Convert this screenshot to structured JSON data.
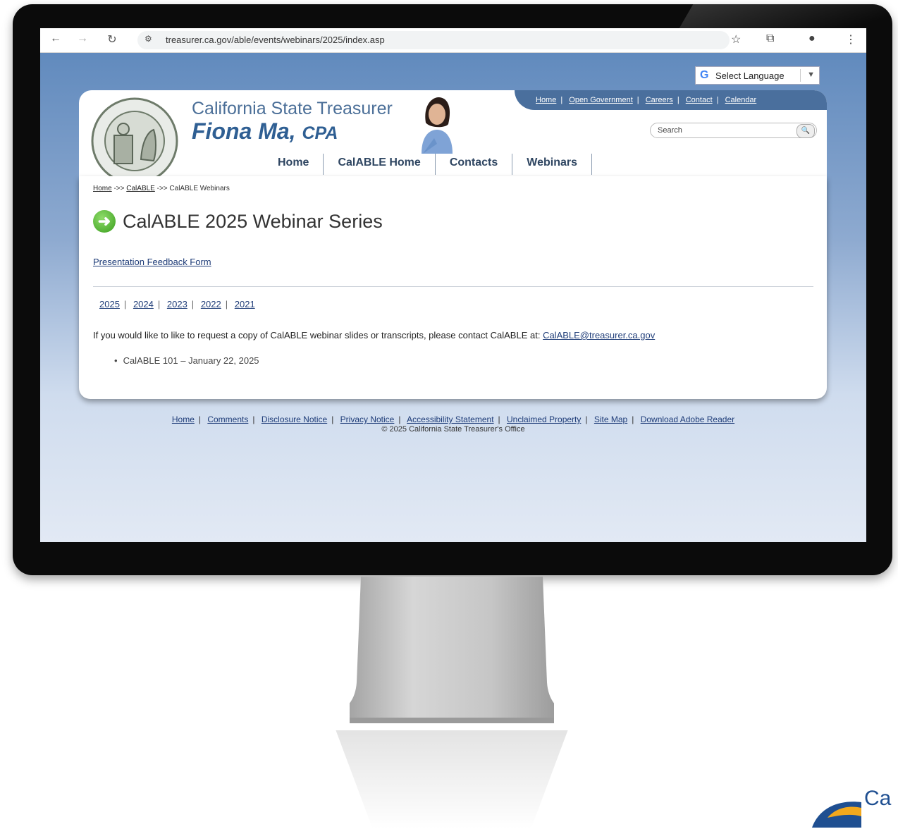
{
  "browser": {
    "url": "treasurer.ca.gov/able/events/webinars/2025/index.asp"
  },
  "translate": {
    "label": "Select Language"
  },
  "header": {
    "topnav": [
      "Home",
      "Open Government",
      "Careers",
      "Contact",
      "Calendar"
    ],
    "title_line1": "California State Treasurer",
    "title_line2": "Fiona Ma,",
    "title_suffix": "CPA",
    "search_placeholder": "Search",
    "mainnav": [
      "Home",
      "CalABLE Home",
      "Contacts",
      "Webinars"
    ]
  },
  "breadcrumb": {
    "items": [
      "Home",
      "CalABLE"
    ],
    "separator": "->>",
    "current": "CalABLE Webinars"
  },
  "page": {
    "title": "CalABLE 2025 Webinar Series",
    "feedback_link": "Presentation Feedback Form",
    "years": [
      "2025",
      "2024",
      "2023",
      "2022",
      "2021"
    ],
    "info_text": "If you would like to like to request a copy of CalABLE webinar slides or transcripts, please contact CalABLE at:",
    "info_email": "CalABLE@treasurer.ca.gov",
    "webinars": [
      "CalABLE 101 – January 22, 2025"
    ]
  },
  "footer": {
    "links": [
      "Home",
      "Comments",
      "Disclosure Notice",
      "Privacy Notice",
      "Accessibility Statement",
      "Unclaimed Property",
      "Site Map",
      "Download Adobe Reader"
    ],
    "copyright": "© 2025 California State Treasurer's Office"
  },
  "brand": {
    "text": "Ca"
  },
  "colors": {
    "accent": "#2f5f93",
    "link": "#1e3c78",
    "nav_bar": "#4a6f9d",
    "go_arrow": "#3a9e1d"
  }
}
